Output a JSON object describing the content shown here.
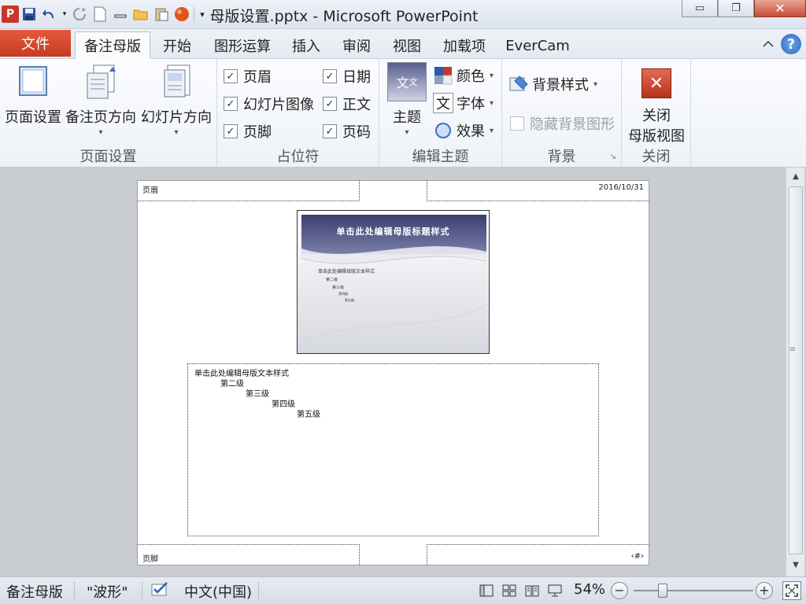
{
  "window": {
    "title": "母版设置.pptx  -  Microsoft PowerPoint",
    "app_badge": "P",
    "minimize": "▭",
    "restore": "❐",
    "close": "✕"
  },
  "tabs": {
    "file": "文件",
    "items": [
      "备注母版",
      "开始",
      "图形运算",
      "插入",
      "审阅",
      "视图",
      "加载项",
      "EverCam"
    ],
    "active_index": 0
  },
  "ribbon": {
    "page_setup_group": {
      "label": "页面设置",
      "buttons": [
        "页面设置",
        "备注页方向",
        "幻灯片方向"
      ]
    },
    "placeholders_group": {
      "label": "占位符",
      "checkboxes": [
        {
          "label": "页眉",
          "checked": true
        },
        {
          "label": "日期",
          "checked": true
        },
        {
          "label": "幻灯片图像",
          "checked": true
        },
        {
          "label": "正文",
          "checked": true
        },
        {
          "label": "页脚",
          "checked": true
        },
        {
          "label": "页码",
          "checked": true
        }
      ]
    },
    "theme_group": {
      "label": "编辑主题",
      "theme_button": "主题",
      "theme_glyph": "文",
      "theme_glyph_small": "文",
      "colors": "颜色",
      "fonts": "字体",
      "fonts_glyph": "文",
      "effects": "效果"
    },
    "background_group": {
      "label": "背景",
      "background_styles": "背景样式",
      "hide_background": "隐藏背景图形",
      "launcher": "↘"
    },
    "close_group": {
      "label": "关闭",
      "close_line1": "关闭",
      "close_line2": "母版视图"
    }
  },
  "page": {
    "header": "页眉",
    "date": "2016/10/31",
    "footer": "页脚",
    "page_number": "‹#›",
    "slide_title": "单击此处编辑母版标题样式",
    "slide_text_levels": [
      "单击此处编辑母版文本样式",
      "第二级",
      "第三级",
      "第四级",
      "第五级"
    ],
    "body_levels": [
      "单击此处编辑母版文本样式",
      "第二级",
      "第三级",
      "第四级",
      "第五级"
    ]
  },
  "statusbar": {
    "view": "备注母版",
    "theme": "\"波形\"",
    "language": "中文(中国)",
    "zoom": "54%",
    "zoom_value": 54,
    "minus": "−",
    "plus": "+"
  },
  "colors": {
    "file_tab": "#d04a2e",
    "accent": "#2f66c0",
    "close_button": "#c74c36",
    "slide_title_band": "#3b3f6e"
  }
}
